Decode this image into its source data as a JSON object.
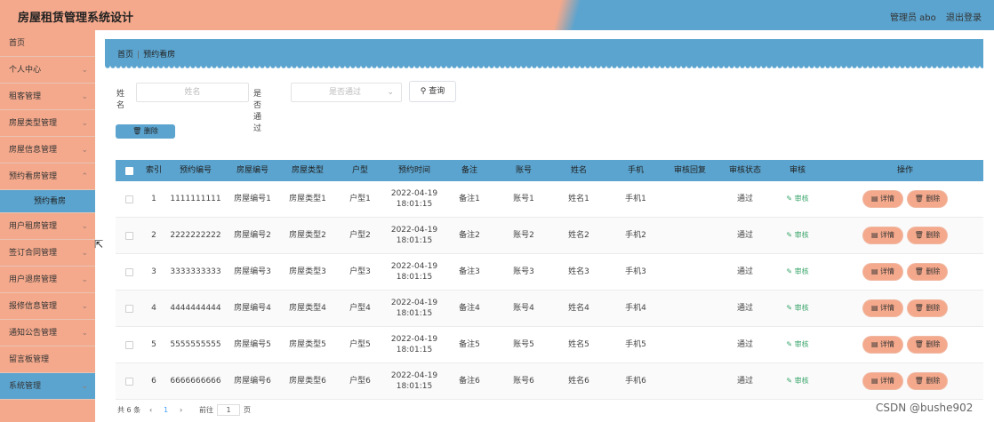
{
  "header": {
    "title": "房屋租赁管理系统设计",
    "admin": "管理员 abo",
    "logout": "退出登录"
  },
  "sidebar": {
    "items": [
      {
        "label": "首页",
        "chevron": false
      },
      {
        "label": "个人中心",
        "chevron": true
      },
      {
        "label": "租客管理",
        "chevron": true
      },
      {
        "label": "房屋类型管理",
        "chevron": true
      },
      {
        "label": "房屋信息管理",
        "chevron": true
      },
      {
        "label": "预约看房管理",
        "chevron": true
      },
      {
        "label": "预约看房",
        "chevron": false,
        "sub": true
      },
      {
        "label": "用户租房管理",
        "chevron": true
      },
      {
        "label": "签订合同管理",
        "chevron": true
      },
      {
        "label": "用户退房管理",
        "chevron": true
      },
      {
        "label": "报修信息管理",
        "chevron": true
      },
      {
        "label": "通知公告管理",
        "chevron": true
      },
      {
        "label": "留言板管理",
        "chevron": false
      },
      {
        "label": "系统管理",
        "chevron": true
      }
    ]
  },
  "breadcrumb": {
    "home": "首页",
    "current": "预约看房"
  },
  "search": {
    "name_label": "姓名",
    "name_placeholder": "姓名",
    "passed_label": "是否通过",
    "passed_placeholder": "是否通过",
    "search_button": "查询"
  },
  "actions": {
    "delete_button": "删除"
  },
  "table": {
    "headers": [
      "索引",
      "预约编号",
      "房屋编号",
      "房屋类型",
      "户型",
      "预约时间",
      "备注",
      "账号",
      "姓名",
      "手机",
      "审核回复",
      "审核状态",
      "审核",
      "操作"
    ],
    "rows": [
      {
        "index": "1",
        "booking_no": "1111111111",
        "house_no": "房屋编号1",
        "house_type": "房屋类型1",
        "layout": "户型1",
        "date": "2022-04-19",
        "time": "18:01:15",
        "note": "备注1",
        "account": "账号1",
        "name": "姓名1",
        "phone": "手机1",
        "reply": "",
        "status": "通过",
        "review": "审核",
        "detail": "详情",
        "delete": "删除"
      },
      {
        "index": "2",
        "booking_no": "2222222222",
        "house_no": "房屋编号2",
        "house_type": "房屋类型2",
        "layout": "户型2",
        "date": "2022-04-19",
        "time": "18:01:15",
        "note": "备注2",
        "account": "账号2",
        "name": "姓名2",
        "phone": "手机2",
        "reply": "",
        "status": "通过",
        "review": "审核",
        "detail": "详情",
        "delete": "删除"
      },
      {
        "index": "3",
        "booking_no": "3333333333",
        "house_no": "房屋编号3",
        "house_type": "房屋类型3",
        "layout": "户型3",
        "date": "2022-04-19",
        "time": "18:01:15",
        "note": "备注3",
        "account": "账号3",
        "name": "姓名3",
        "phone": "手机3",
        "reply": "",
        "status": "通过",
        "review": "审核",
        "detail": "详情",
        "delete": "删除"
      },
      {
        "index": "4",
        "booking_no": "4444444444",
        "house_no": "房屋编号4",
        "house_type": "房屋类型4",
        "layout": "户型4",
        "date": "2022-04-19",
        "time": "18:01:15",
        "note": "备注4",
        "account": "账号4",
        "name": "姓名4",
        "phone": "手机4",
        "reply": "",
        "status": "通过",
        "review": "审核",
        "detail": "详情",
        "delete": "删除"
      },
      {
        "index": "5",
        "booking_no": "5555555555",
        "house_no": "房屋编号5",
        "house_type": "房屋类型5",
        "layout": "户型5",
        "date": "2022-04-19",
        "time": "18:01:15",
        "note": "备注5",
        "account": "账号5",
        "name": "姓名5",
        "phone": "手机5",
        "reply": "",
        "status": "通过",
        "review": "审核",
        "detail": "详情",
        "delete": "删除"
      },
      {
        "index": "6",
        "booking_no": "6666666666",
        "house_no": "房屋编号6",
        "house_type": "房屋类型6",
        "layout": "户型6",
        "date": "2022-04-19",
        "time": "18:01:15",
        "note": "备注6",
        "account": "账号6",
        "name": "姓名6",
        "phone": "手机6",
        "reply": "",
        "status": "通过",
        "review": "审核",
        "detail": "详情",
        "delete": "删除"
      }
    ]
  },
  "pagination": {
    "total": "共 6 条",
    "prev": "‹",
    "current": "1",
    "next": "›",
    "goto": "前往",
    "page_value": "1",
    "page_unit": "页"
  },
  "watermark": "CSDN @bushe902",
  "colors": {
    "salmon": "#f4a98c",
    "blue": "#5ba4cf",
    "review_green": "#3aa56b"
  }
}
